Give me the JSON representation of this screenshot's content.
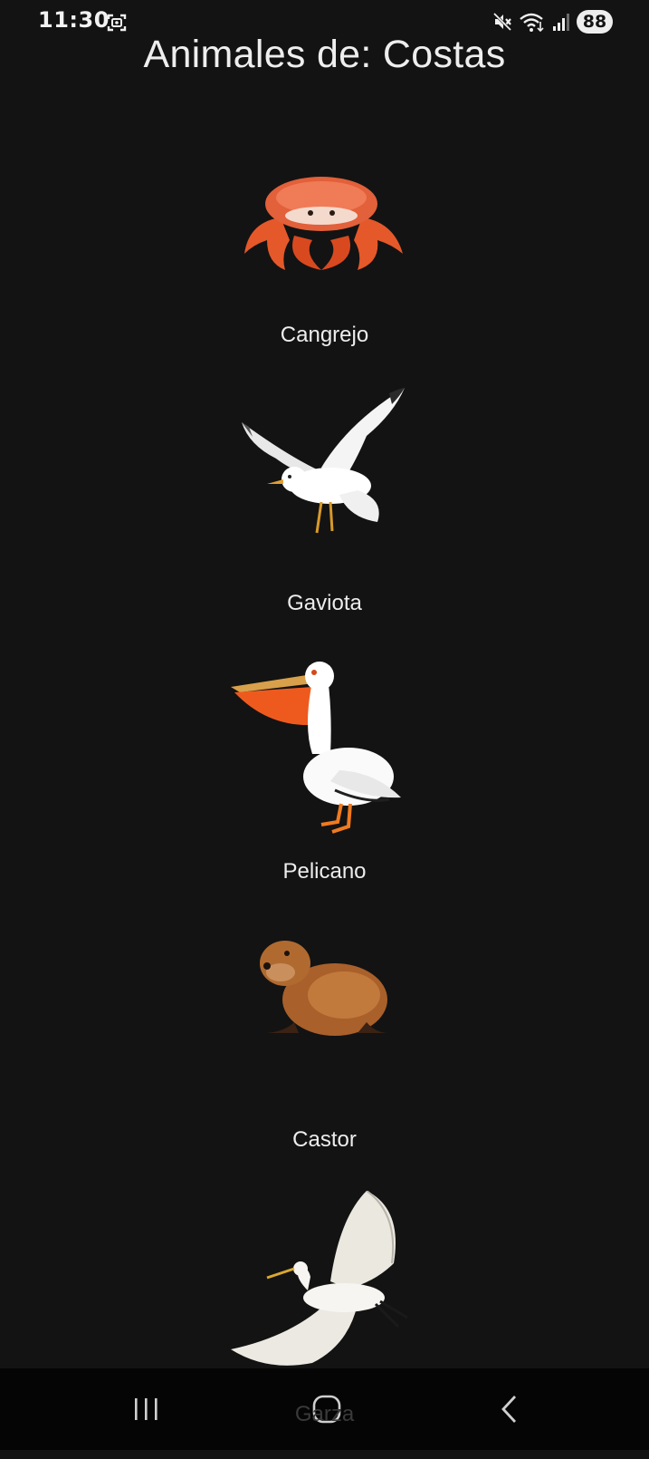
{
  "status_bar": {
    "time": "11:30",
    "battery": "88",
    "icons": [
      "screenshot-icon",
      "mute-icon",
      "wifi-icon",
      "signal-icon"
    ]
  },
  "page": {
    "title": "Animales de: Costas"
  },
  "animals": [
    {
      "name": "Cangrejo",
      "icon": "crab-icon"
    },
    {
      "name": "Gaviota",
      "icon": "seagull-icon"
    },
    {
      "name": "Pelicano",
      "icon": "pelican-icon"
    },
    {
      "name": "Castor",
      "icon": "beaver-icon"
    },
    {
      "name": "Garza",
      "icon": "heron-icon"
    }
  ],
  "nav_bar": {
    "buttons": [
      "recents-icon",
      "home-icon",
      "back-icon"
    ]
  },
  "colors": {
    "background": "#131313",
    "text": "#eeeeee",
    "nav_background": "#050505"
  }
}
